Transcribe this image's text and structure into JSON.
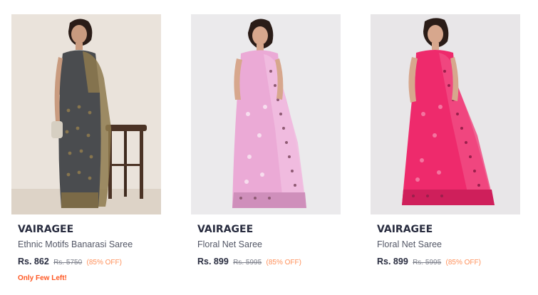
{
  "products": [
    {
      "brand": "VAIRAGEE",
      "title": "Ethnic Motifs Banarasi Saree",
      "price": "Rs. 862",
      "mrp": "Rs. 5750",
      "discount": "(85% OFF)",
      "badge": "Only Few Left!",
      "colors": {
        "saree": "#4a4c4f",
        "accent": "#8e7a4e",
        "background": "#eae3db"
      }
    },
    {
      "brand": "VAIRAGEE",
      "title": "Floral Net Saree",
      "price": "Rs. 899",
      "mrp": "Rs. 5995",
      "discount": "(85% OFF)",
      "colors": {
        "saree": "#ebaad6",
        "accent": "#8e5a73",
        "background": "#ebeaec"
      }
    },
    {
      "brand": "VAIRAGEE",
      "title": "Floral Net Saree",
      "price": "Rs. 899",
      "mrp": "Rs. 5995",
      "discount": "(85% OFF)",
      "colors": {
        "saree": "#ee2a6c",
        "accent": "#9b1f4c",
        "background": "#e8e6e8"
      }
    }
  ],
  "colors": {
    "price_off": "#ff905a",
    "few_left": "#ff5722"
  }
}
